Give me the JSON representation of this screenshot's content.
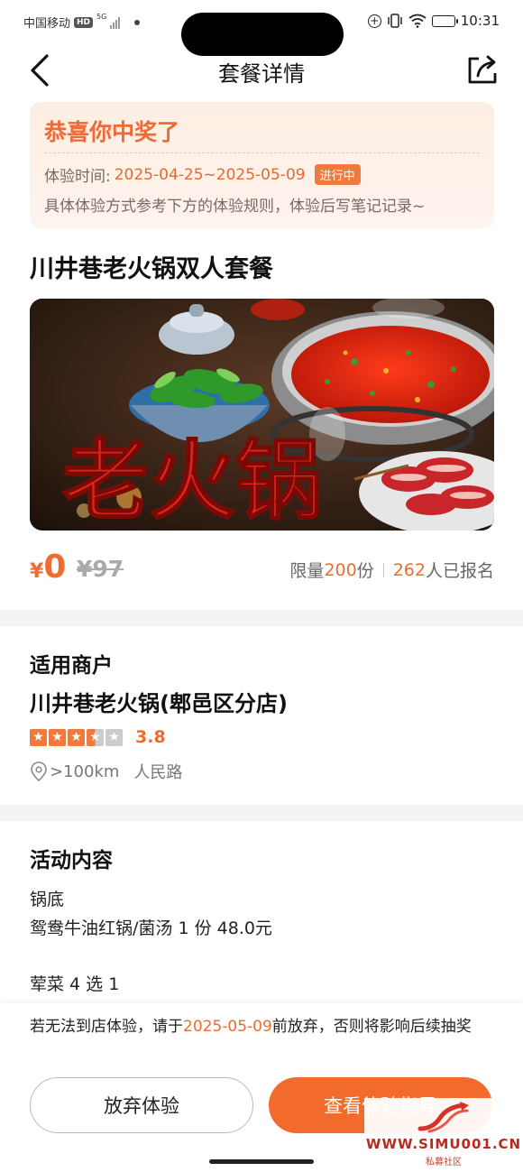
{
  "status_bar": {
    "carrier": "中国移动",
    "hd": "HD",
    "network": "5G",
    "time": "10:31"
  },
  "nav": {
    "title": "套餐详情",
    "back_icon": "chevron-left-icon",
    "share_icon": "share-icon"
  },
  "prize": {
    "title": "恭喜你中奖了",
    "time_label": "体验时间:",
    "time_range": "2025-04-25~2025-05-09",
    "status_badge": "进行中",
    "note": "具体体验方式参考下方的体验规则，体验后写笔记记录~"
  },
  "product": {
    "title": "川井巷老火锅双人套餐",
    "hero_caption": "老火锅",
    "price_symbol": "¥",
    "price_now": "0",
    "price_original": "¥97",
    "quota_prefix": "限量",
    "quota_count": "200",
    "quota_suffix": "份",
    "signup_count": "262",
    "signup_suffix": "人已报名"
  },
  "merchant": {
    "section_title": "适用商户",
    "name": "川井巷老火锅(郫邑区分店)",
    "rating": "3.8",
    "rating_stars": 3.5,
    "distance": ">100km",
    "address": "人民路"
  },
  "activity": {
    "section_title": "活动内容",
    "lines": [
      "锅底",
      "鸳鸯牛油红锅/菌汤  1 份  48.0元",
      "荤菜 4 选 1"
    ]
  },
  "bottom": {
    "warn_prefix": "若无法到店体验，请于",
    "warn_date": "2025-05-09",
    "warn_suffix": "前放弃，否则将影响后续抽奖",
    "quit_label": "放弃体验",
    "view_label": "查看体验指导"
  },
  "watermark": {
    "url": "WWW.SIMU001.CN",
    "sub": "私募社区"
  },
  "colors": {
    "accent": "#ef6b2f",
    "card_bg": "#fdeee2",
    "band": "#f3f3f3"
  }
}
